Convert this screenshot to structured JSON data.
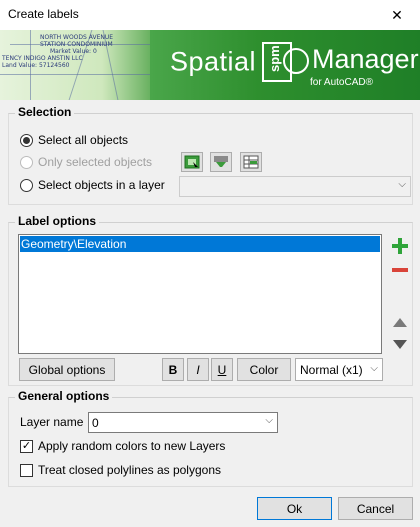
{
  "window": {
    "title": "Create labels",
    "close_glyph": "✕"
  },
  "banner": {
    "brand_left": "Spatial",
    "brand_box": "spm",
    "brand_right": "Manager",
    "subtitle": "for AutoCAD®",
    "map_text": [
      "NORTH WOODS AVENUE",
      "STATION CONDOMINIUM",
      "Market Value: 0",
      "TENCY INDIGO ANSTIN LLC",
      "Land Value: 57124560"
    ]
  },
  "selection": {
    "title": "Selection",
    "options": [
      {
        "label": "Select all objects",
        "checked": true,
        "enabled": true
      },
      {
        "label": "Only selected objects",
        "checked": false,
        "enabled": false
      },
      {
        "label": "Select objects in a layer",
        "checked": false,
        "enabled": true
      }
    ],
    "tool_icons": [
      "select-window-icon",
      "filter-select-icon",
      "table-select-icon"
    ],
    "layer_combo_value": ""
  },
  "label_options": {
    "title": "Label options",
    "items": [
      "Geometry\\Elevation"
    ],
    "global_options_label": "Global options",
    "bold_label": "B",
    "italic_label": "I",
    "underline_label": "U",
    "color_label": "Color",
    "size_value": "Normal (x1)",
    "side_icons": [
      "add-icon",
      "remove-icon",
      "move-up-icon",
      "move-down-icon"
    ]
  },
  "general_options": {
    "title": "General options",
    "layer_name_label": "Layer name",
    "layer_name_value": "0",
    "apply_random_colors_label": "Apply random colors to new Layers",
    "apply_random_colors_checked": true,
    "treat_closed_label": "Treat closed polylines as polygons",
    "treat_closed_checked": false
  },
  "footer": {
    "ok_label": "Ok",
    "cancel_label": "Cancel"
  },
  "colors": {
    "accent": "#0078d7",
    "brand_green": "#2e8f2e",
    "add_green": "#2fa43a",
    "remove_red": "#d9443a"
  }
}
